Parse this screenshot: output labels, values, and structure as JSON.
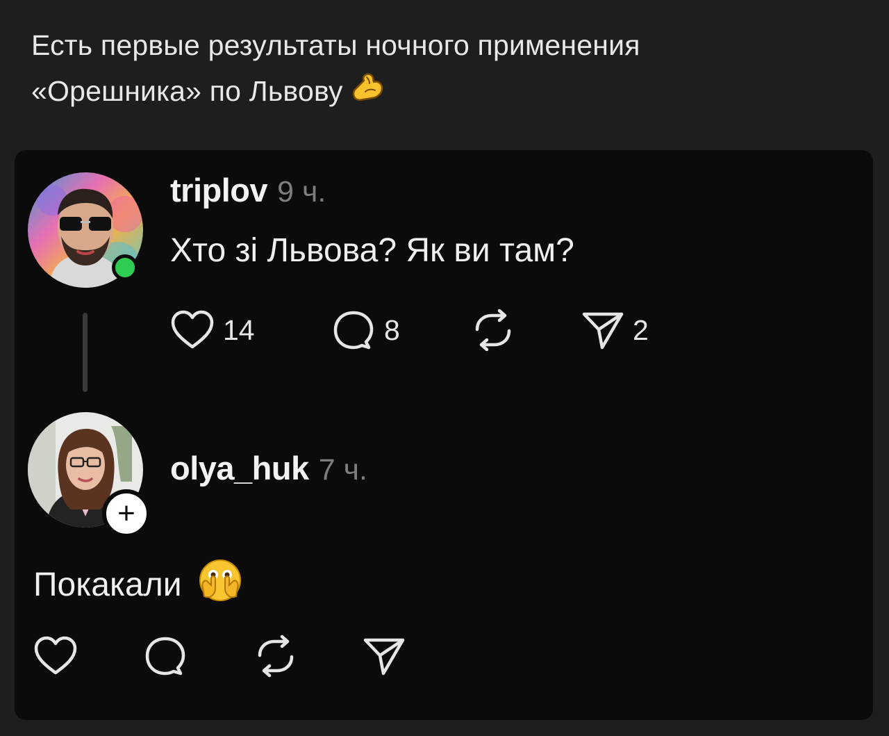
{
  "caption": {
    "line1": "Есть первые результаты ночного применения",
    "line2": "«Орешника» по Львову",
    "emoji_icon": "flexed-biceps-emoji"
  },
  "post1": {
    "username": "triplov",
    "time": "9 ч.",
    "text": "Хто зі Львова? Як ви там?",
    "status": "online-dot",
    "likes": "14",
    "comments": "8",
    "shares": "2"
  },
  "post2": {
    "username": "olya_huk",
    "time": "7 ч.",
    "text": "Покакали",
    "text_emoji": "face-with-open-eyes-and-hand-over-mouth-emoji",
    "follow_badge": "+"
  },
  "colors": {
    "page_bg": "#1e1e1e",
    "card_bg": "#0b0b0b",
    "online": "#2fcc52",
    "muted": "#7d7d7d"
  }
}
